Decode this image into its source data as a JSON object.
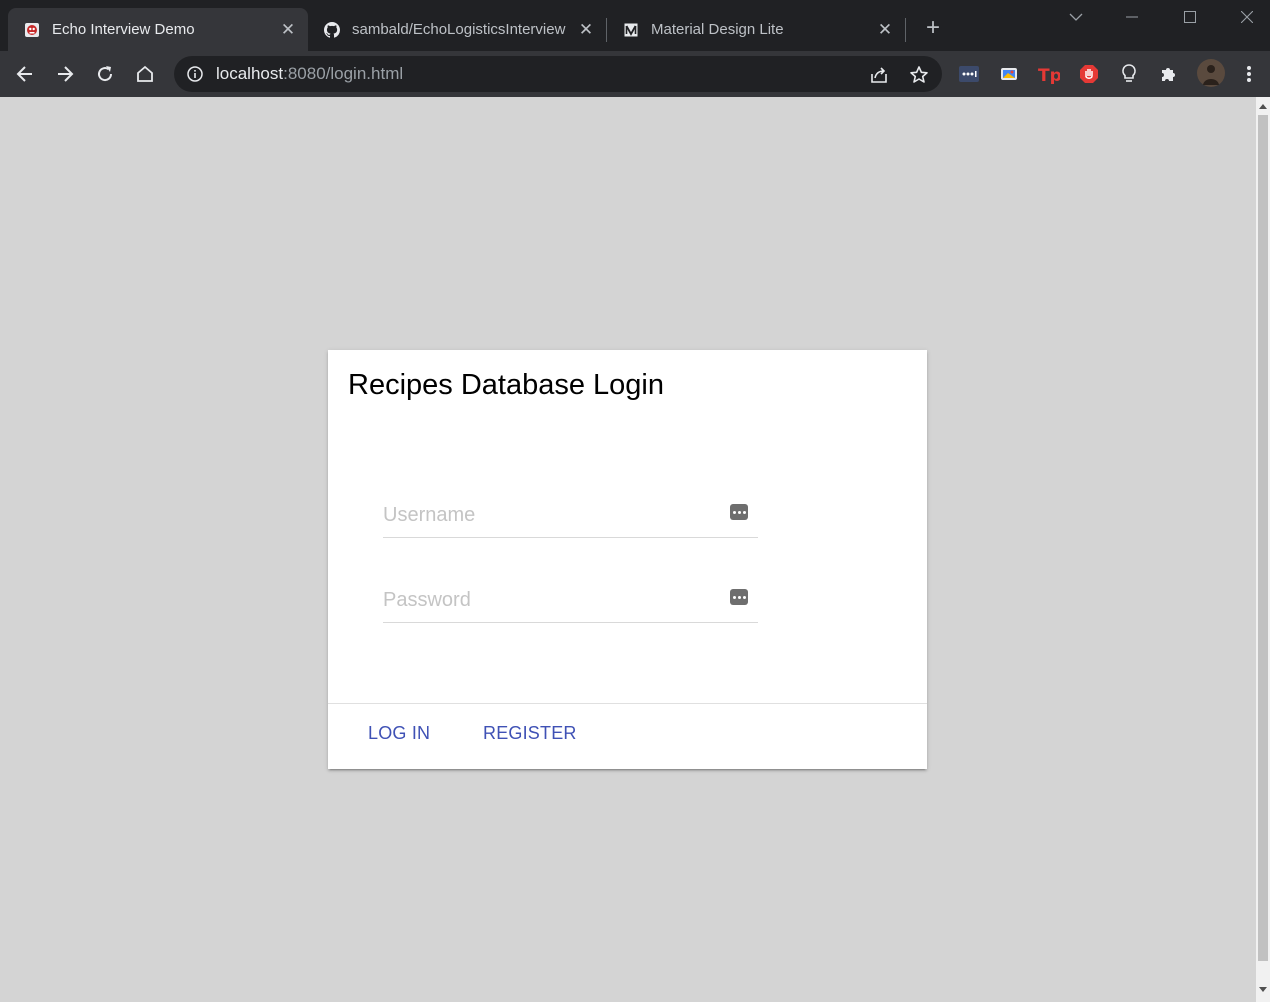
{
  "browser": {
    "tabs": [
      {
        "title": "Echo Interview Demo",
        "icon": "echo-favicon-icon",
        "active": true
      },
      {
        "title": "sambald/EchoLogisticsInterview",
        "icon": "github-icon",
        "active": false
      },
      {
        "title": "Material Design Lite",
        "icon": "mdl-icon",
        "active": false
      }
    ],
    "new_tab_label": "+",
    "close_glyph": "✕",
    "address": {
      "host": "localhost",
      "rest": ":8080/login.html"
    },
    "colors": {
      "tabstrip": "#202124",
      "toolbar": "#35363a",
      "omnibox": "#202124"
    }
  },
  "page": {
    "card_title": "Recipes Database Login",
    "username": {
      "placeholder": "Username",
      "value": ""
    },
    "password": {
      "placeholder": "Password",
      "value": ""
    },
    "actions": {
      "login_label": "LOG IN",
      "register_label": "REGISTER"
    },
    "colors": {
      "background": "#d4d4d4",
      "accent": "#3f51b5"
    }
  }
}
